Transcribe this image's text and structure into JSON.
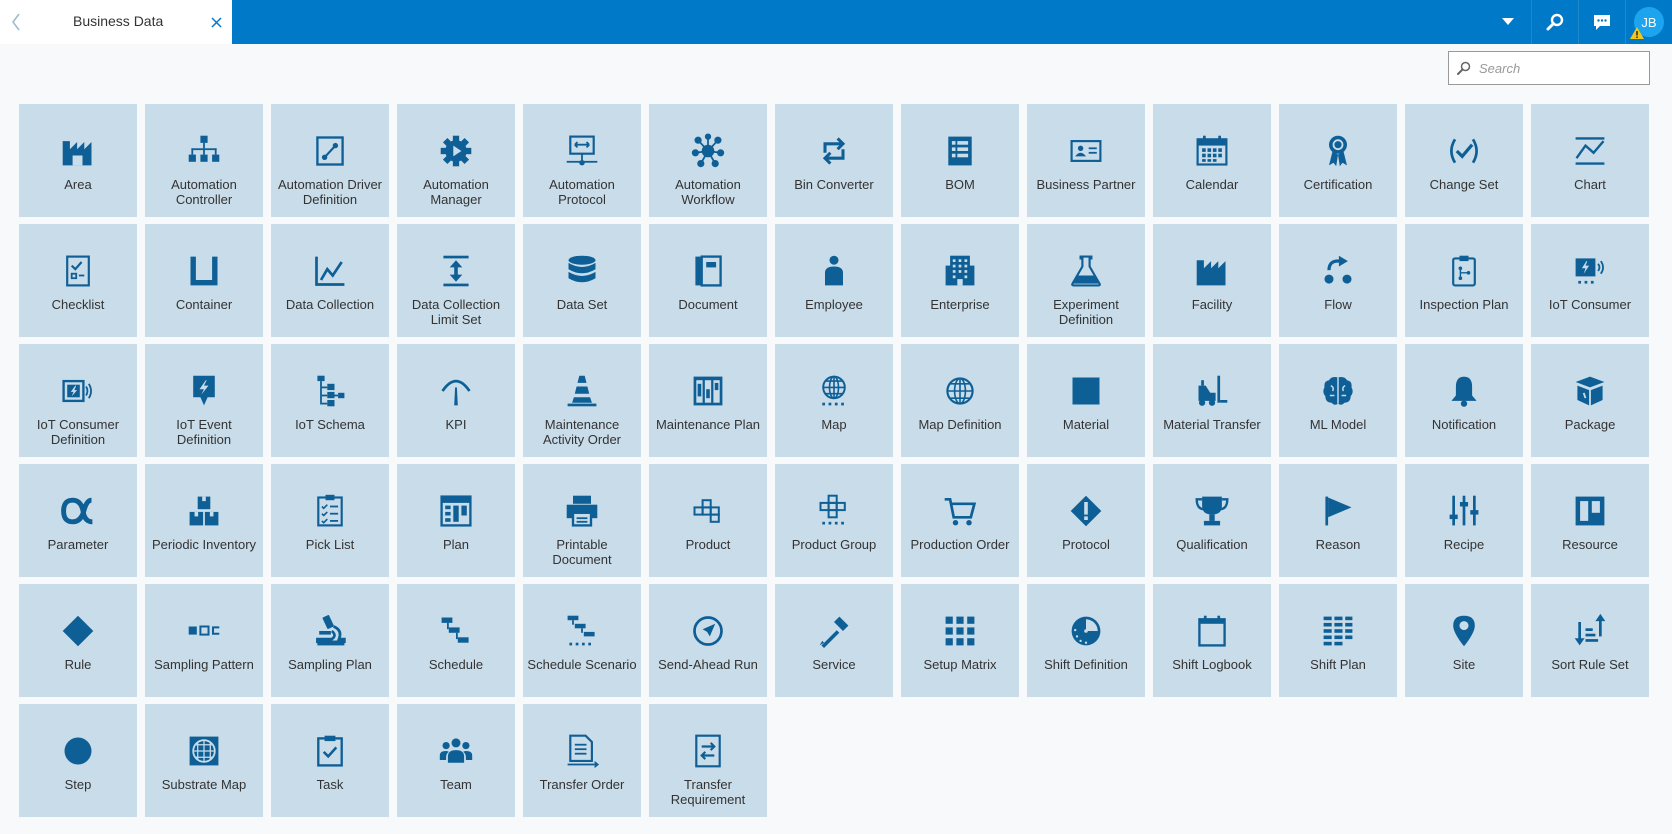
{
  "header": {
    "tab_title": "Business Data",
    "user_initials": "JB"
  },
  "search": {
    "placeholder": "Search",
    "value": ""
  },
  "tiles": [
    {
      "label": "Area",
      "icon": "factory-outline-icon"
    },
    {
      "label": "Automation Controller",
      "icon": "hierarchy-icon"
    },
    {
      "label": "Automation Driver Definition",
      "icon": "driver-icon"
    },
    {
      "label": "Automation Manager",
      "icon": "gear-play-icon"
    },
    {
      "label": "Automation Protocol",
      "icon": "protocol-board-icon"
    },
    {
      "label": "Automation Workflow",
      "icon": "network-icon"
    },
    {
      "label": "Bin Converter",
      "icon": "refresh-arrows-icon"
    },
    {
      "label": "BOM",
      "icon": "bom-list-icon"
    },
    {
      "label": "Business Partner",
      "icon": "id-card-icon"
    },
    {
      "label": "Calendar",
      "icon": "calendar-icon"
    },
    {
      "label": "Certification",
      "icon": "award-icon"
    },
    {
      "label": "Change Set",
      "icon": "change-check-icon"
    },
    {
      "label": "Chart",
      "icon": "chart-line-icon"
    },
    {
      "label": "Checklist",
      "icon": "checklist-icon"
    },
    {
      "label": "Container",
      "icon": "container-icon"
    },
    {
      "label": "Data Collection",
      "icon": "data-line-icon"
    },
    {
      "label": "Data Collection Limit Set",
      "icon": "limit-arrows-icon"
    },
    {
      "label": "Data Set",
      "icon": "database-icon"
    },
    {
      "label": "Document",
      "icon": "document-icon"
    },
    {
      "label": "Employee",
      "icon": "person-icon"
    },
    {
      "label": "Enterprise",
      "icon": "building-icon"
    },
    {
      "label": "Experiment Definition",
      "icon": "flask-icon"
    },
    {
      "label": "Facility",
      "icon": "factory-solid-icon"
    },
    {
      "label": "Flow",
      "icon": "flow-icon"
    },
    {
      "label": "Inspection Plan",
      "icon": "clipboard-flow-icon"
    },
    {
      "label": "IoT Consumer",
      "icon": "iot-consumer-icon"
    },
    {
      "label": "IoT Consumer Definition",
      "icon": "iot-consumer-def-icon"
    },
    {
      "label": "IoT Event Definition",
      "icon": "iot-event-icon"
    },
    {
      "label": "IoT Schema",
      "icon": "tree-schema-icon"
    },
    {
      "label": "KPI",
      "icon": "gauge-icon"
    },
    {
      "label": "Maintenance Activity Order",
      "icon": "traffic-cone-icon"
    },
    {
      "label": "Maintenance Plan",
      "icon": "maintenance-plan-icon"
    },
    {
      "label": "Map",
      "icon": "map-globe-dotted-icon"
    },
    {
      "label": "Map Definition",
      "icon": "map-globe-icon"
    },
    {
      "label": "Material",
      "icon": "square-icon"
    },
    {
      "label": "Material Transfer",
      "icon": "forklift-icon"
    },
    {
      "label": "ML Model",
      "icon": "brain-icon"
    },
    {
      "label": "Notification",
      "icon": "bell-icon"
    },
    {
      "label": "Package",
      "icon": "package-icon"
    },
    {
      "label": "Parameter",
      "icon": "alpha-icon"
    },
    {
      "label": "Periodic Inventory",
      "icon": "boxes-icon"
    },
    {
      "label": "Pick List",
      "icon": "pick-list-icon"
    },
    {
      "label": "Plan",
      "icon": "plan-grid-icon"
    },
    {
      "label": "Printable Document",
      "icon": "printer-icon"
    },
    {
      "label": "Product",
      "icon": "product-icon"
    },
    {
      "label": "Product Group",
      "icon": "product-group-icon"
    },
    {
      "label": "Production Order",
      "icon": "cart-icon"
    },
    {
      "label": "Protocol",
      "icon": "diamond-alert-icon"
    },
    {
      "label": "Qualification",
      "icon": "trophy-icon"
    },
    {
      "label": "Reason",
      "icon": "flag-icon"
    },
    {
      "label": "Recipe",
      "icon": "sliders-icon"
    },
    {
      "label": "Resource",
      "icon": "kanban-icon"
    },
    {
      "label": "Rule",
      "icon": "diamond-icon"
    },
    {
      "label": "Sampling Pattern",
      "icon": "sampling-pattern-icon"
    },
    {
      "label": "Sampling Plan",
      "icon": "microscope-icon"
    },
    {
      "label": "Schedule",
      "icon": "schedule-icon"
    },
    {
      "label": "Schedule Scenario",
      "icon": "schedule-scenario-icon"
    },
    {
      "label": "Send-Ahead Run",
      "icon": "compass-icon"
    },
    {
      "label": "Service",
      "icon": "screwdriver-icon"
    },
    {
      "label": "Setup Matrix",
      "icon": "matrix-icon"
    },
    {
      "label": "Shift Definition",
      "icon": "clock-pie-icon"
    },
    {
      "label": "Shift Logbook",
      "icon": "logbook-icon"
    },
    {
      "label": "Shift Plan",
      "icon": "shift-plan-icon"
    },
    {
      "label": "Site",
      "icon": "map-pin-icon"
    },
    {
      "label": "Sort Rule Set",
      "icon": "sort-icon"
    },
    {
      "label": "Step",
      "icon": "circle-icon"
    },
    {
      "label": "Substrate Map",
      "icon": "substrate-map-icon"
    },
    {
      "label": "Task",
      "icon": "task-clipboard-icon"
    },
    {
      "label": "Team",
      "icon": "team-icon"
    },
    {
      "label": "Transfer Order",
      "icon": "transfer-order-icon"
    },
    {
      "label": "Transfer Requirement",
      "icon": "transfer-requirement-icon"
    }
  ],
  "colors": {
    "brand": "#0079c8",
    "tile": "#c9dce9",
    "icon": "#0f5f97",
    "avatar": "#1ca5ee",
    "warning": "#f5c518"
  }
}
